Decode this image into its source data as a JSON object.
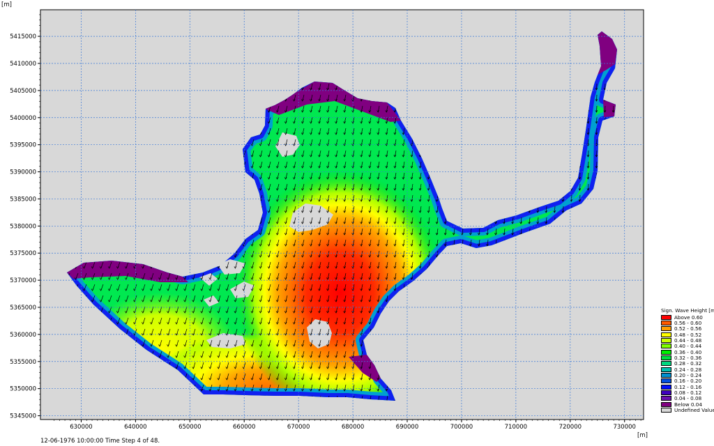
{
  "chart_data": {
    "type": "heatmap",
    "y_unit": "[m]",
    "x_unit": "[m]",
    "xlim": [
      622500,
      733500
    ],
    "ylim": [
      5344300,
      5419900
    ],
    "x_ticks": [
      "630000",
      "640000",
      "650000",
      "660000",
      "670000",
      "680000",
      "690000",
      "700000",
      "710000",
      "720000",
      "730000"
    ],
    "y_ticks": [
      "5345000",
      "5350000",
      "5355000",
      "5360000",
      "5365000",
      "5370000",
      "5375000",
      "5380000",
      "5385000",
      "5390000",
      "5395000",
      "5400000",
      "5405000",
      "5410000",
      "5415000"
    ],
    "grid": true,
    "legend_title": "Sign. Wave Height [m]",
    "legend": [
      {
        "label": "Above 0.60",
        "color": "#ff0000"
      },
      {
        "label": "0.56 - 0.60",
        "color": "#ff5a00"
      },
      {
        "label": "0.52 - 0.56",
        "color": "#ff9c00"
      },
      {
        "label": "0.48 - 0.52",
        "color": "#ffff00"
      },
      {
        "label": "0.44 - 0.48",
        "color": "#ccff00"
      },
      {
        "label": "0.40 - 0.44",
        "color": "#80ff00"
      },
      {
        "label": "0.36 - 0.40",
        "color": "#00f000"
      },
      {
        "label": "0.32 - 0.36",
        "color": "#00e040"
      },
      {
        "label": "0.28 - 0.32",
        "color": "#00d880"
      },
      {
        "label": "0.24 - 0.28",
        "color": "#00c0b0"
      },
      {
        "label": "0.20 - 0.24",
        "color": "#0090d0"
      },
      {
        "label": "0.16 - 0.20",
        "color": "#0050e0"
      },
      {
        "label": "0.12 - 0.16",
        "color": "#0010ff"
      },
      {
        "label": "0.08 - 0.12",
        "color": "#4000c0"
      },
      {
        "label": "0.04 - 0.08",
        "color": "#6a10b0"
      },
      {
        "label": "Below 0.04",
        "color": "#800080"
      },
      {
        "label": "Undefined Value",
        "color": "#d8d8d8"
      }
    ]
  },
  "status": "12-06-1976 10:00:00  Time Step 4 of 48."
}
